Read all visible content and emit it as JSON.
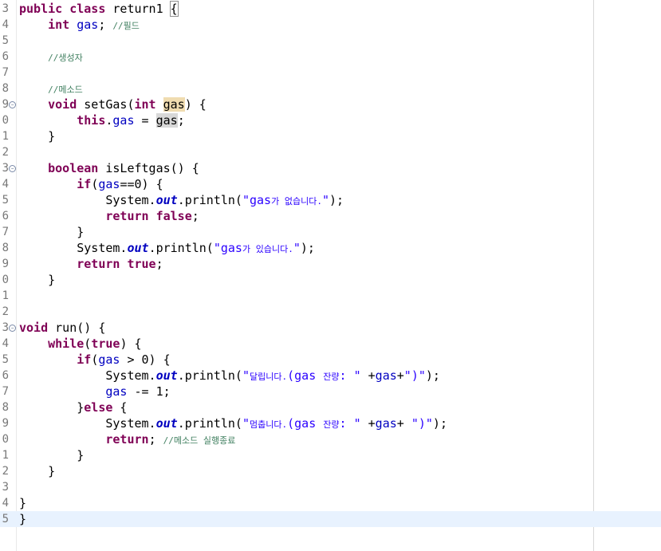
{
  "editor": {
    "line_numbers": [
      "3",
      "4",
      "5",
      "6",
      "7",
      "8",
      "9",
      "0",
      "1",
      "2",
      "3",
      "4",
      "5",
      "6",
      "7",
      "8",
      "9",
      "0",
      "1",
      "2",
      "3",
      "4",
      "5",
      "6",
      "7",
      "8",
      "9",
      "0",
      "1",
      "2",
      "3",
      "4",
      "5"
    ],
    "lines": [
      {
        "tokens": [
          {
            "t": "public",
            "c": "kw"
          },
          {
            "t": " "
          },
          {
            "t": "class",
            "c": "kw"
          },
          {
            "t": " return1 "
          },
          {
            "t": "{",
            "c": "bracket-box"
          }
        ]
      },
      {
        "tokens": [
          {
            "t": "    "
          },
          {
            "t": "int",
            "c": "kw"
          },
          {
            "t": " "
          },
          {
            "t": "gas",
            "c": "fld"
          },
          {
            "t": "; "
          },
          {
            "t": "//필드",
            "c": "cm small"
          }
        ]
      },
      {
        "tokens": []
      },
      {
        "tokens": [
          {
            "t": "    "
          },
          {
            "t": "//생성자",
            "c": "cm small"
          }
        ]
      },
      {
        "tokens": []
      },
      {
        "tokens": [
          {
            "t": "    "
          },
          {
            "t": "//메소드",
            "c": "cm small"
          }
        ]
      },
      {
        "fold": true,
        "tokens": [
          {
            "t": "    "
          },
          {
            "t": "void",
            "c": "kw"
          },
          {
            "t": " setGas("
          },
          {
            "t": "int",
            "c": "kw"
          },
          {
            "t": " "
          },
          {
            "t": "gas",
            "c": "hl-decl"
          },
          {
            "t": ") {"
          }
        ]
      },
      {
        "tokens": [
          {
            "t": "        "
          },
          {
            "t": "this",
            "c": "kw"
          },
          {
            "t": "."
          },
          {
            "t": "gas",
            "c": "fld"
          },
          {
            "t": " = "
          },
          {
            "t": "gas",
            "c": "hl-use"
          },
          {
            "t": ";"
          }
        ]
      },
      {
        "tokens": [
          {
            "t": "    }"
          }
        ]
      },
      {
        "tokens": []
      },
      {
        "fold": true,
        "tokens": [
          {
            "t": "    "
          },
          {
            "t": "boolean",
            "c": "kw"
          },
          {
            "t": " isLeftgas() {"
          }
        ]
      },
      {
        "tokens": [
          {
            "t": "        "
          },
          {
            "t": "if",
            "c": "kw"
          },
          {
            "t": "("
          },
          {
            "t": "gas",
            "c": "fld"
          },
          {
            "t": "==0) {"
          }
        ]
      },
      {
        "tokens": [
          {
            "t": "            System."
          },
          {
            "t": "out",
            "c": "it"
          },
          {
            "t": ".println("
          },
          {
            "t": "\"gas",
            "c": "str"
          },
          {
            "t": "가 없습니다.",
            "c": "str small"
          },
          {
            "t": "\"",
            "c": "str"
          },
          {
            "t": ");"
          }
        ]
      },
      {
        "tokens": [
          {
            "t": "            "
          },
          {
            "t": "return",
            "c": "kw"
          },
          {
            "t": " "
          },
          {
            "t": "false",
            "c": "kw"
          },
          {
            "t": ";"
          }
        ]
      },
      {
        "tokens": [
          {
            "t": "        }"
          }
        ]
      },
      {
        "tokens": [
          {
            "t": "        System."
          },
          {
            "t": "out",
            "c": "it"
          },
          {
            "t": ".println("
          },
          {
            "t": "\"gas",
            "c": "str"
          },
          {
            "t": "가 있습니다.",
            "c": "str small"
          },
          {
            "t": "\"",
            "c": "str"
          },
          {
            "t": ");"
          }
        ]
      },
      {
        "tokens": [
          {
            "t": "        "
          },
          {
            "t": "return",
            "c": "kw"
          },
          {
            "t": " "
          },
          {
            "t": "true",
            "c": "kw"
          },
          {
            "t": ";"
          }
        ]
      },
      {
        "tokens": [
          {
            "t": "    }"
          }
        ]
      },
      {
        "tokens": []
      },
      {
        "tokens": []
      },
      {
        "fold": true,
        "tokens": [
          {
            "t": "void",
            "c": "kw"
          },
          {
            "t": " run() {"
          }
        ]
      },
      {
        "tokens": [
          {
            "t": "    "
          },
          {
            "t": "while",
            "c": "kw"
          },
          {
            "t": "("
          },
          {
            "t": "true",
            "c": "kw"
          },
          {
            "t": ") {"
          }
        ]
      },
      {
        "tokens": [
          {
            "t": "        "
          },
          {
            "t": "if",
            "c": "kw"
          },
          {
            "t": "("
          },
          {
            "t": "gas",
            "c": "fld"
          },
          {
            "t": " > 0) {"
          }
        ]
      },
      {
        "tokens": [
          {
            "t": "            System."
          },
          {
            "t": "out",
            "c": "it"
          },
          {
            "t": ".println("
          },
          {
            "t": "\"",
            "c": "str"
          },
          {
            "t": "달립니다.",
            "c": "str small"
          },
          {
            "t": "(gas ",
            "c": "str"
          },
          {
            "t": "잔량",
            "c": "str small"
          },
          {
            "t": ": \"",
            "c": "str"
          },
          {
            "t": " +"
          },
          {
            "t": "gas",
            "c": "fld"
          },
          {
            "t": "+"
          },
          {
            "t": "\")\"",
            "c": "str"
          },
          {
            "t": ");"
          }
        ]
      },
      {
        "tokens": [
          {
            "t": "            "
          },
          {
            "t": "gas",
            "c": "fld"
          },
          {
            "t": " -= 1;"
          }
        ]
      },
      {
        "tokens": [
          {
            "t": "        }"
          },
          {
            "t": "else",
            "c": "kw"
          },
          {
            "t": " {"
          }
        ]
      },
      {
        "tokens": [
          {
            "t": "            System."
          },
          {
            "t": "out",
            "c": "it"
          },
          {
            "t": ".println("
          },
          {
            "t": "\"",
            "c": "str"
          },
          {
            "t": "멈춥니다.",
            "c": "str small"
          },
          {
            "t": "(gas ",
            "c": "str"
          },
          {
            "t": "잔량",
            "c": "str small"
          },
          {
            "t": ": \"",
            "c": "str"
          },
          {
            "t": " +"
          },
          {
            "t": "gas",
            "c": "fld"
          },
          {
            "t": "+ "
          },
          {
            "t": "\")\"",
            "c": "str"
          },
          {
            "t": ");"
          }
        ]
      },
      {
        "tokens": [
          {
            "t": "            "
          },
          {
            "t": "return",
            "c": "kw"
          },
          {
            "t": "; "
          },
          {
            "t": "//메소드 실행종료",
            "c": "cm small"
          }
        ]
      },
      {
        "tokens": [
          {
            "t": "        }"
          }
        ]
      },
      {
        "tokens": [
          {
            "t": "    }"
          }
        ]
      },
      {
        "tokens": []
      },
      {
        "tokens": [
          {
            "t": "}"
          }
        ]
      },
      {
        "current": true,
        "tokens": [
          {
            "t": "}"
          }
        ]
      }
    ]
  }
}
